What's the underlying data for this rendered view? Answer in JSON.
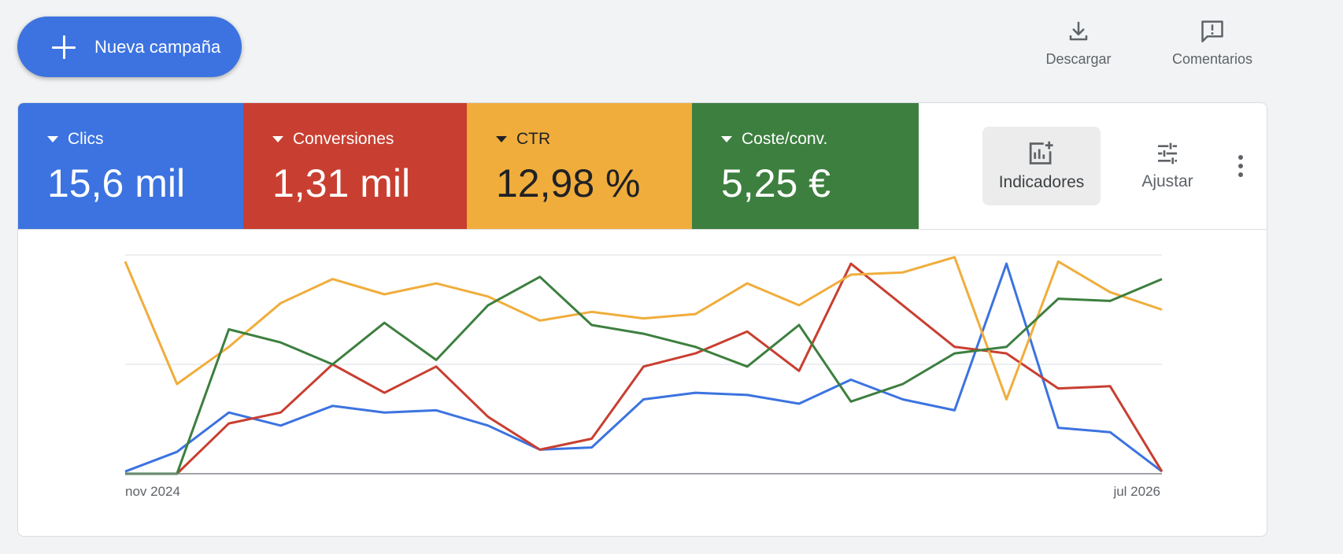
{
  "header": {
    "new_campaign_label": "Nueva campaña",
    "download_label": "Descargar",
    "feedback_label": "Comentarios"
  },
  "metrics": [
    {
      "label": "Clics",
      "value": "15,6 mil",
      "color": "#3c73e0"
    },
    {
      "label": "Conversiones",
      "value": "1,31 mil",
      "color": "#c83f31"
    },
    {
      "label": "CTR",
      "value": "12,98 %",
      "color": "#f0ad3c"
    },
    {
      "label": "Coste/conv.",
      "value": "5,25 €",
      "color": "#3d7f3f"
    }
  ],
  "tools": {
    "indicadores_label": "Indicadores",
    "ajustar_label": "Ajustar"
  },
  "icons": {
    "plus": "plus-icon",
    "download": "download-icon",
    "feedback": "feedback-icon",
    "indicadores": "add-chart-icon",
    "ajustar": "tune-icon",
    "more": "more-vert-icon"
  },
  "chart_data": {
    "type": "line",
    "x_start_label": "nov 2024",
    "x_end_label": "jul 2026",
    "ylim": [
      0,
      1
    ],
    "grid": true,
    "series": [
      {
        "color": "#3c73e0",
        "values": [
          0.01,
          0.1,
          0.28,
          0.22,
          0.31,
          0.28,
          0.29,
          0.22,
          0.11,
          0.12,
          0.34,
          0.37,
          0.36,
          0.32,
          0.43,
          0.34,
          0.29,
          0.96,
          0.21,
          0.19,
          0.01
        ]
      },
      {
        "color": "#c83f31",
        "values": [
          0.0,
          0.0,
          0.23,
          0.28,
          0.5,
          0.37,
          0.49,
          0.26,
          0.11,
          0.16,
          0.49,
          0.55,
          0.65,
          0.47,
          0.96,
          0.77,
          0.58,
          0.55,
          0.39,
          0.4,
          0.01
        ]
      },
      {
        "color": "#f0ad3c",
        "values": [
          0.97,
          0.41,
          0.58,
          0.78,
          0.89,
          0.82,
          0.87,
          0.81,
          0.7,
          0.74,
          0.71,
          0.73,
          0.87,
          0.77,
          0.91,
          0.92,
          0.99,
          0.34,
          0.97,
          0.83,
          0.75
        ]
      },
      {
        "color": "#3d7f3f",
        "values": [
          0.0,
          0.0,
          0.66,
          0.6,
          0.5,
          0.69,
          0.52,
          0.77,
          0.9,
          0.68,
          0.64,
          0.58,
          0.49,
          0.68,
          0.33,
          0.41,
          0.55,
          0.58,
          0.8,
          0.79,
          0.89
        ]
      }
    ]
  }
}
